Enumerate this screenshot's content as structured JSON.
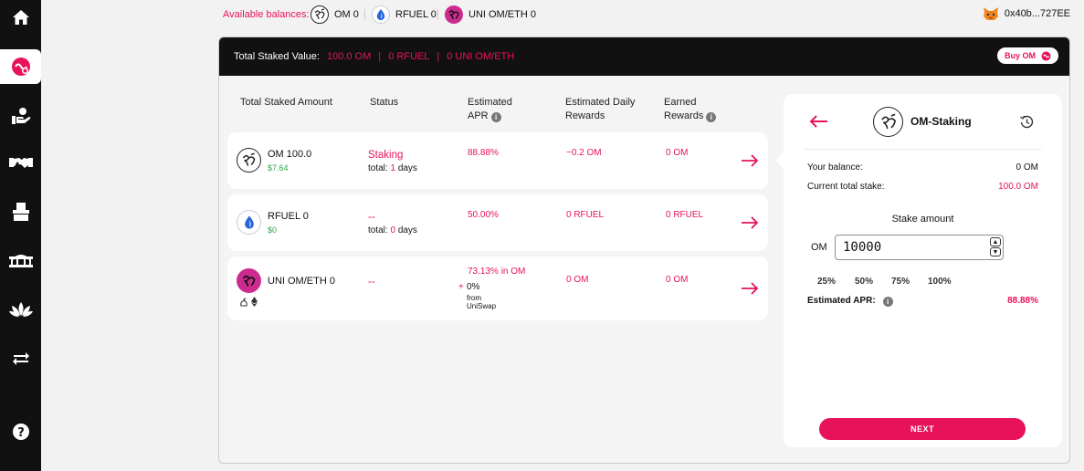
{
  "topbar": {
    "balances_label": "Available balances:",
    "balances": [
      {
        "token": "OM",
        "amount": "OM 0",
        "icon": "om-icon"
      },
      {
        "token": "RFUEL",
        "amount": "RFUEL 0",
        "icon": "rfuel-icon"
      },
      {
        "token": "UNI OM/ETH",
        "amount": "UNI OM/ETH 0",
        "icon": "uni-om-eth-icon"
      }
    ],
    "wallet_address": "0x40b...727EE"
  },
  "sidebar": {
    "items": [
      {
        "name": "home",
        "icon": "home-icon"
      },
      {
        "name": "staking",
        "icon": "staking-icon",
        "active": true
      },
      {
        "name": "lending",
        "icon": "hand-coin-icon"
      },
      {
        "name": "farming",
        "icon": "handshake-icon"
      },
      {
        "name": "governance",
        "icon": "ballot-box-icon"
      },
      {
        "name": "bridge",
        "icon": "bridge-icon"
      },
      {
        "name": "lotus",
        "icon": "lotus-icon"
      },
      {
        "name": "swap",
        "icon": "swap-icon"
      },
      {
        "name": "help",
        "icon": "help-icon"
      }
    ]
  },
  "summary": {
    "label": "Total Staked Value:",
    "om": "100.0 OM",
    "rfuel": "0 RFUEL",
    "uni": "0 UNI OM/ETH",
    "sep": "|",
    "buy_label": "Buy OM"
  },
  "table": {
    "headers": {
      "amount": "Total Staked Amount",
      "status": "Status",
      "apr_1": "Estimated",
      "apr_2": "APR",
      "daily_1": "Estimated Daily",
      "daily_2": "Rewards",
      "earned_1": "Earned",
      "earned_2": "Rewards"
    },
    "rows": [
      {
        "token": "OM 100.0",
        "usd": "$7.64",
        "status": "Staking",
        "total_prefix": "total:",
        "total_days": "1",
        "total_suffix": "days",
        "apr": "88.88%",
        "daily": "~0.2 OM",
        "earned": "0 OM"
      },
      {
        "token": "RFUEL 0",
        "usd": "$0",
        "status": "--",
        "total_prefix": "total:",
        "total_days": "0",
        "total_suffix": "days",
        "apr": "50.00%",
        "daily": "0 RFUEL",
        "earned": "0 RFUEL"
      },
      {
        "token": "UNI OM/ETH 0",
        "status": "--",
        "apr_main": "73.13% in OM",
        "apr_plus": "+",
        "apr_extra": "0%",
        "apr_from": "from",
        "apr_source": "UniSwap",
        "daily": "0 OM",
        "earned": "0 OM"
      }
    ]
  },
  "panel": {
    "title": "OM-Staking",
    "your_balance_label": "Your balance:",
    "your_balance": "0 OM",
    "total_stake_label": "Current total stake:",
    "total_stake": "100.0 OM",
    "stake_amount_label": "Stake amount",
    "currency": "OM",
    "input_value": "10000",
    "percentages": [
      "25%",
      "50%",
      "75%",
      "100%"
    ],
    "apr_label": "Estimated APR:",
    "apr_value": "88.88%",
    "next_label": "NEXT"
  },
  "colors": {
    "accent": "#e8125b",
    "sidebar": "#111111",
    "green": "#2aa84a"
  }
}
